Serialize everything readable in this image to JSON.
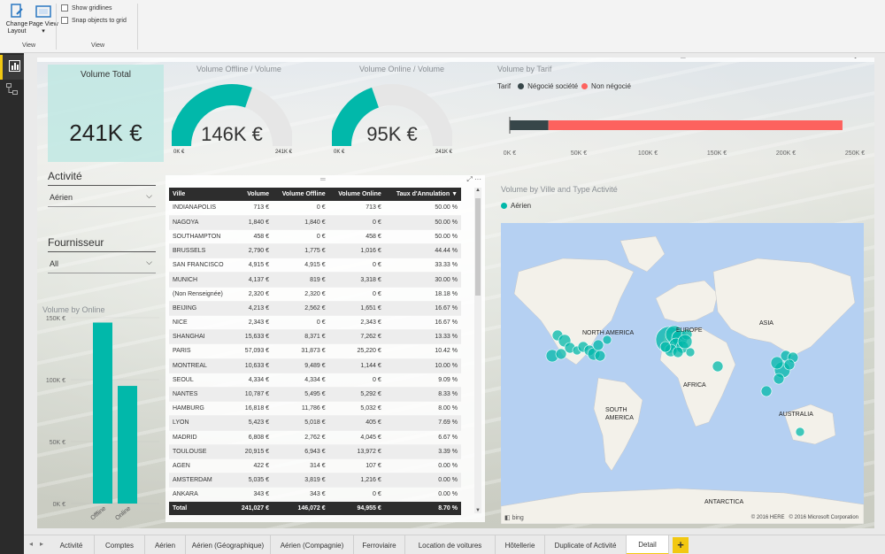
{
  "ribbon": {
    "change_layout": "Change Layout",
    "page_view": "Page View",
    "view_group_label": "View",
    "show_gridlines": "Show gridlines",
    "snap_objects": "Snap objects to grid",
    "view_group_label2": "View"
  },
  "card": {
    "title": "Volume Total",
    "value": "241K €"
  },
  "gauge_offline": {
    "title": "Volume Offline / Volume",
    "value": "146K €",
    "min": "0K €",
    "max": "241K €",
    "fraction": 0.606
  },
  "gauge_online": {
    "title": "Volume Online / Volume",
    "value": "95K €",
    "min": "0K €",
    "max": "241K €",
    "fraction": 0.394
  },
  "slicer_activite": {
    "title": "Activité",
    "value": "Aérien"
  },
  "slicer_fournisseur": {
    "title": "Fournisseur",
    "value": "All"
  },
  "table": {
    "columns": [
      "Ville",
      "Volume",
      "Volume Offline",
      "Volume Online",
      "Taux d'Annulation"
    ],
    "rows": [
      [
        "INDIANAPOLIS",
        "713 €",
        "0 €",
        "713 €",
        "50.00 %"
      ],
      [
        "NAGOYA",
        "1,840 €",
        "1,840 €",
        "0 €",
        "50.00 %"
      ],
      [
        "SOUTHAMPTON",
        "458 €",
        "0 €",
        "458 €",
        "50.00 %"
      ],
      [
        "BRUSSELS",
        "2,790 €",
        "1,775 €",
        "1,016 €",
        "44.44 %"
      ],
      [
        "SAN FRANCISCO",
        "4,915 €",
        "4,915 €",
        "0 €",
        "33.33 %"
      ],
      [
        "MUNICH",
        "4,137 €",
        "819 €",
        "3,318 €",
        "30.00 %"
      ],
      [
        "(Non Renseignée)",
        "2,320 €",
        "2,320 €",
        "0 €",
        "18.18 %"
      ],
      [
        "BEIJING",
        "4,213 €",
        "2,562 €",
        "1,651 €",
        "16.67 %"
      ],
      [
        "NICE",
        "2,343 €",
        "0 €",
        "2,343 €",
        "16.67 %"
      ],
      [
        "SHANGHAI",
        "15,633 €",
        "8,371 €",
        "7,262 €",
        "13.33 %"
      ],
      [
        "PARIS",
        "57,093 €",
        "31,873 €",
        "25,220 €",
        "10.42 %"
      ],
      [
        "MONTREAL",
        "10,633 €",
        "9,489 €",
        "1,144 €",
        "10.00 %"
      ],
      [
        "SEOUL",
        "4,334 €",
        "4,334 €",
        "0 €",
        "9.09 %"
      ],
      [
        "NANTES",
        "10,787 €",
        "5,495 €",
        "5,292 €",
        "8.33 %"
      ],
      [
        "HAMBURG",
        "16,818 €",
        "11,786 €",
        "5,032 €",
        "8.00 %"
      ],
      [
        "LYON",
        "5,423 €",
        "5,018 €",
        "405 €",
        "7.69 %"
      ],
      [
        "MADRID",
        "6,808 €",
        "2,762 €",
        "4,045 €",
        "6.67 %"
      ],
      [
        "TOULOUSE",
        "20,915 €",
        "6,943 €",
        "13,972 €",
        "3.39 %"
      ],
      [
        "AGEN",
        "422 €",
        "314 €",
        "107 €",
        "0.00 %"
      ],
      [
        "AMSTERDAM",
        "5,035 €",
        "3,819 €",
        "1,216 €",
        "0.00 %"
      ],
      [
        "ANKARA",
        "343 €",
        "343 €",
        "0 €",
        "0.00 %"
      ]
    ],
    "total": [
      "Total",
      "241,027 €",
      "146,072 €",
      "94,955 €",
      "8.70 %"
    ]
  },
  "bar_chart": {
    "title": "Volume by Online",
    "chart_data": {
      "type": "bar",
      "categories": [
        "Offline",
        "Online"
      ],
      "values": [
        146072,
        94955
      ],
      "yticks": [
        "0K €",
        "50K €",
        "100K €",
        "150K €"
      ],
      "ylim": [
        0,
        150000
      ],
      "color": "#01b8aa"
    }
  },
  "tarif_chart": {
    "title": "Volume by Tarif",
    "legend_title": "Tarif",
    "legend": [
      {
        "name": "Négocié société",
        "color": "#374649"
      },
      {
        "name": "Non négocié",
        "color": "#fd625e"
      }
    ],
    "chart_data": {
      "type": "bar",
      "orientation": "horizontal-stacked",
      "series": [
        {
          "name": "Négocié société",
          "values": [
            28000
          ]
        },
        {
          "name": "Non négocié",
          "values": [
            213000
          ]
        }
      ],
      "xticks": [
        "0K €",
        "50K €",
        "100K €",
        "150K €",
        "200K €",
        "250K €"
      ],
      "xlim": [
        0,
        250000
      ]
    }
  },
  "map": {
    "title": "Volume by Ville and Type Activité",
    "legend": "Aérien",
    "labels": [
      "NORTH AMERICA",
      "EUROPE",
      "ASIA",
      "AFRICA",
      "SOUTH AMERICA",
      "AUSTRALIA",
      "ANTARCTICA"
    ],
    "bing": "bing",
    "copyright": "© 2016 HERE   © 2016 Microsoft Corporation"
  },
  "tabs": [
    "Activité",
    "Comptes",
    "Aérien",
    "Aérien (Géographique)",
    "Aérien (Compagnie)",
    "Ferroviaire",
    "Location de voitures",
    "Hôtellerie",
    "Duplicate of Activité",
    "Detail"
  ],
  "active_tab": "Detail",
  "add_tab": "+",
  "colors": {
    "teal": "#01b8aa",
    "dark": "#374649",
    "red": "#fd625e",
    "accent": "#f2c811"
  }
}
